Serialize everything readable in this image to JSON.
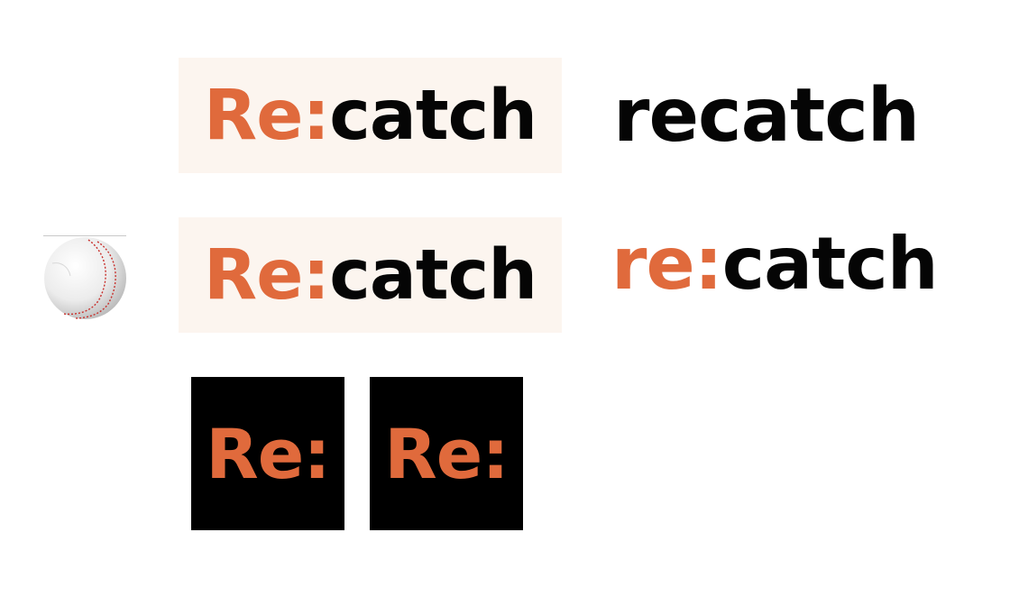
{
  "colors": {
    "accent": "#e06a3c",
    "dark": "#050505",
    "cream_background": "#fcf5ef",
    "mark_background": "#000000"
  },
  "logos": {
    "logo_1": {
      "accent_part": "Re:",
      "dark_part": "catch"
    },
    "logo_2": {
      "accent_part": "Re:",
      "dark_part": "catch"
    },
    "logo_3": {
      "dark_part": "recatch"
    },
    "logo_4": {
      "accent_part": "re:",
      "dark_part": "catch"
    }
  },
  "marks": {
    "mark_1": {
      "text": "Re:"
    },
    "mark_2": {
      "text": "Re:"
    }
  },
  "icons": {
    "baseball": "baseball-icon"
  }
}
